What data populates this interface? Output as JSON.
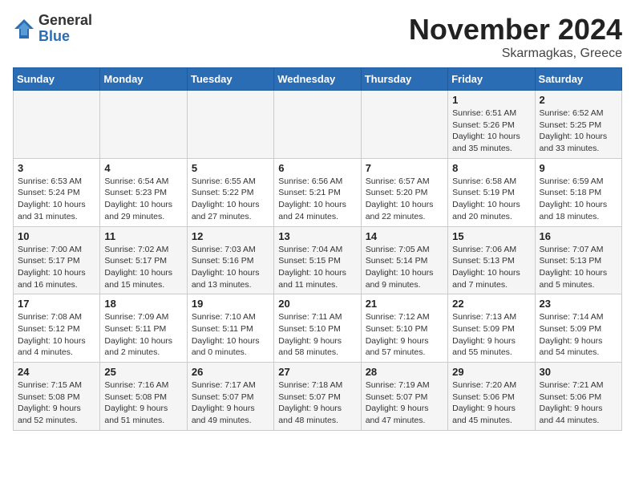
{
  "header": {
    "logo_general": "General",
    "logo_blue": "Blue",
    "month_title": "November 2024",
    "location": "Skarmagkas, Greece"
  },
  "days_of_week": [
    "Sunday",
    "Monday",
    "Tuesday",
    "Wednesday",
    "Thursday",
    "Friday",
    "Saturday"
  ],
  "weeks": [
    [
      {
        "day": "",
        "info": ""
      },
      {
        "day": "",
        "info": ""
      },
      {
        "day": "",
        "info": ""
      },
      {
        "day": "",
        "info": ""
      },
      {
        "day": "",
        "info": ""
      },
      {
        "day": "1",
        "info": "Sunrise: 6:51 AM\nSunset: 5:26 PM\nDaylight: 10 hours and 35 minutes."
      },
      {
        "day": "2",
        "info": "Sunrise: 6:52 AM\nSunset: 5:25 PM\nDaylight: 10 hours and 33 minutes."
      }
    ],
    [
      {
        "day": "3",
        "info": "Sunrise: 6:53 AM\nSunset: 5:24 PM\nDaylight: 10 hours and 31 minutes."
      },
      {
        "day": "4",
        "info": "Sunrise: 6:54 AM\nSunset: 5:23 PM\nDaylight: 10 hours and 29 minutes."
      },
      {
        "day": "5",
        "info": "Sunrise: 6:55 AM\nSunset: 5:22 PM\nDaylight: 10 hours and 27 minutes."
      },
      {
        "day": "6",
        "info": "Sunrise: 6:56 AM\nSunset: 5:21 PM\nDaylight: 10 hours and 24 minutes."
      },
      {
        "day": "7",
        "info": "Sunrise: 6:57 AM\nSunset: 5:20 PM\nDaylight: 10 hours and 22 minutes."
      },
      {
        "day": "8",
        "info": "Sunrise: 6:58 AM\nSunset: 5:19 PM\nDaylight: 10 hours and 20 minutes."
      },
      {
        "day": "9",
        "info": "Sunrise: 6:59 AM\nSunset: 5:18 PM\nDaylight: 10 hours and 18 minutes."
      }
    ],
    [
      {
        "day": "10",
        "info": "Sunrise: 7:00 AM\nSunset: 5:17 PM\nDaylight: 10 hours and 16 minutes."
      },
      {
        "day": "11",
        "info": "Sunrise: 7:02 AM\nSunset: 5:17 PM\nDaylight: 10 hours and 15 minutes."
      },
      {
        "day": "12",
        "info": "Sunrise: 7:03 AM\nSunset: 5:16 PM\nDaylight: 10 hours and 13 minutes."
      },
      {
        "day": "13",
        "info": "Sunrise: 7:04 AM\nSunset: 5:15 PM\nDaylight: 10 hours and 11 minutes."
      },
      {
        "day": "14",
        "info": "Sunrise: 7:05 AM\nSunset: 5:14 PM\nDaylight: 10 hours and 9 minutes."
      },
      {
        "day": "15",
        "info": "Sunrise: 7:06 AM\nSunset: 5:13 PM\nDaylight: 10 hours and 7 minutes."
      },
      {
        "day": "16",
        "info": "Sunrise: 7:07 AM\nSunset: 5:13 PM\nDaylight: 10 hours and 5 minutes."
      }
    ],
    [
      {
        "day": "17",
        "info": "Sunrise: 7:08 AM\nSunset: 5:12 PM\nDaylight: 10 hours and 4 minutes."
      },
      {
        "day": "18",
        "info": "Sunrise: 7:09 AM\nSunset: 5:11 PM\nDaylight: 10 hours and 2 minutes."
      },
      {
        "day": "19",
        "info": "Sunrise: 7:10 AM\nSunset: 5:11 PM\nDaylight: 10 hours and 0 minutes."
      },
      {
        "day": "20",
        "info": "Sunrise: 7:11 AM\nSunset: 5:10 PM\nDaylight: 9 hours and 58 minutes."
      },
      {
        "day": "21",
        "info": "Sunrise: 7:12 AM\nSunset: 5:10 PM\nDaylight: 9 hours and 57 minutes."
      },
      {
        "day": "22",
        "info": "Sunrise: 7:13 AM\nSunset: 5:09 PM\nDaylight: 9 hours and 55 minutes."
      },
      {
        "day": "23",
        "info": "Sunrise: 7:14 AM\nSunset: 5:09 PM\nDaylight: 9 hours and 54 minutes."
      }
    ],
    [
      {
        "day": "24",
        "info": "Sunrise: 7:15 AM\nSunset: 5:08 PM\nDaylight: 9 hours and 52 minutes."
      },
      {
        "day": "25",
        "info": "Sunrise: 7:16 AM\nSunset: 5:08 PM\nDaylight: 9 hours and 51 minutes."
      },
      {
        "day": "26",
        "info": "Sunrise: 7:17 AM\nSunset: 5:07 PM\nDaylight: 9 hours and 49 minutes."
      },
      {
        "day": "27",
        "info": "Sunrise: 7:18 AM\nSunset: 5:07 PM\nDaylight: 9 hours and 48 minutes."
      },
      {
        "day": "28",
        "info": "Sunrise: 7:19 AM\nSunset: 5:07 PM\nDaylight: 9 hours and 47 minutes."
      },
      {
        "day": "29",
        "info": "Sunrise: 7:20 AM\nSunset: 5:06 PM\nDaylight: 9 hours and 45 minutes."
      },
      {
        "day": "30",
        "info": "Sunrise: 7:21 AM\nSunset: 5:06 PM\nDaylight: 9 hours and 44 minutes."
      }
    ]
  ]
}
